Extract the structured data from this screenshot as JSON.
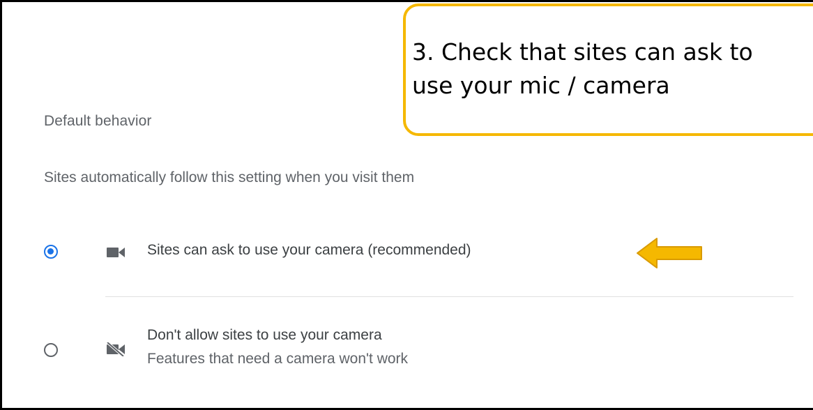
{
  "default_behavior": {
    "title": "Default behavior",
    "subtitle": "Sites automatically follow this setting when you visit them",
    "options": [
      {
        "label": "Sites can ask to use your camera (recommended)",
        "selected": true,
        "icon": "camera-icon"
      },
      {
        "label": "Don't allow sites to use your camera",
        "description": "Features that need a camera won't work",
        "selected": false,
        "icon": "camera-off-icon"
      }
    ]
  },
  "callout": {
    "line1": "3. Check that sites can ask to",
    "line2": "use your mic / camera"
  },
  "colors": {
    "accent": "#1a73e8",
    "callout_border": "#f5b800",
    "arrow_fill": "#f5b800",
    "text_secondary": "#5f6368"
  }
}
